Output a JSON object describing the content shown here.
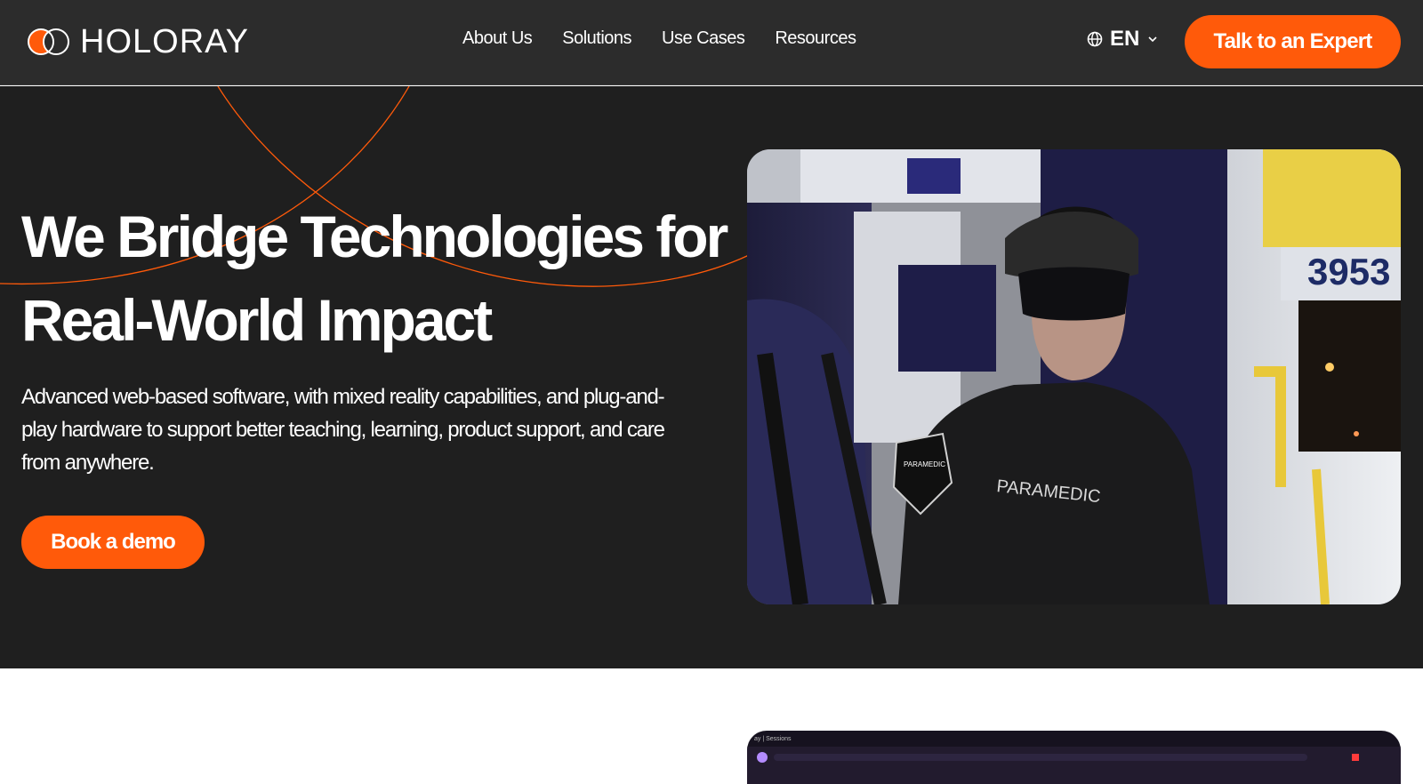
{
  "header": {
    "logo_text": "HOLORAY",
    "nav": [
      "About Us",
      "Solutions",
      "Use Cases",
      "Resources"
    ],
    "language": "EN",
    "cta_label": "Talk to an Expert"
  },
  "hero": {
    "title_line1": "We Bridge Technologies for",
    "title_line2": "Real-World Impact",
    "subtitle": "Advanced web-based software, with mixed reality capabilities, and plug-and-play hardware to support better teaching, learning, product support, and care from anywhere.",
    "cta_label": "Book a demo",
    "image": {
      "unit_number": "3953",
      "patch_text": "PARAMEDIC",
      "badge_text": "PARAMEDIC"
    }
  },
  "lower": {
    "browser_tab_label": "ay | Sessions"
  },
  "colors": {
    "accent": "#ff5a0a",
    "header_bg": "#2c2c2c",
    "hero_bg": "#1f1f1f"
  },
  "icons": [
    "logo-icon",
    "globe-icon",
    "chevron-down-icon"
  ]
}
